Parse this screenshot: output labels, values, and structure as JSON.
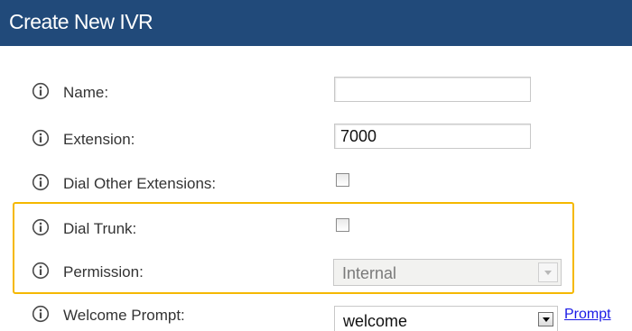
{
  "header": {
    "title": "Create New IVR",
    "color": "#214a7a"
  },
  "highlight_color": "#f5b800",
  "form": {
    "name": {
      "label": "Name:",
      "value": ""
    },
    "extension": {
      "label": "Extension:",
      "value": "7000"
    },
    "dial_other_extensions": {
      "label": "Dial Other Extensions:",
      "checked": false
    },
    "dial_trunk": {
      "label": "Dial Trunk:",
      "checked": false
    },
    "permission": {
      "label": "Permission:",
      "value": "Internal",
      "disabled": true
    },
    "welcome_prompt": {
      "label": "Welcome Prompt:",
      "value": "welcome",
      "link_text": "Prompt"
    }
  },
  "icons": {
    "info": "info-icon"
  }
}
